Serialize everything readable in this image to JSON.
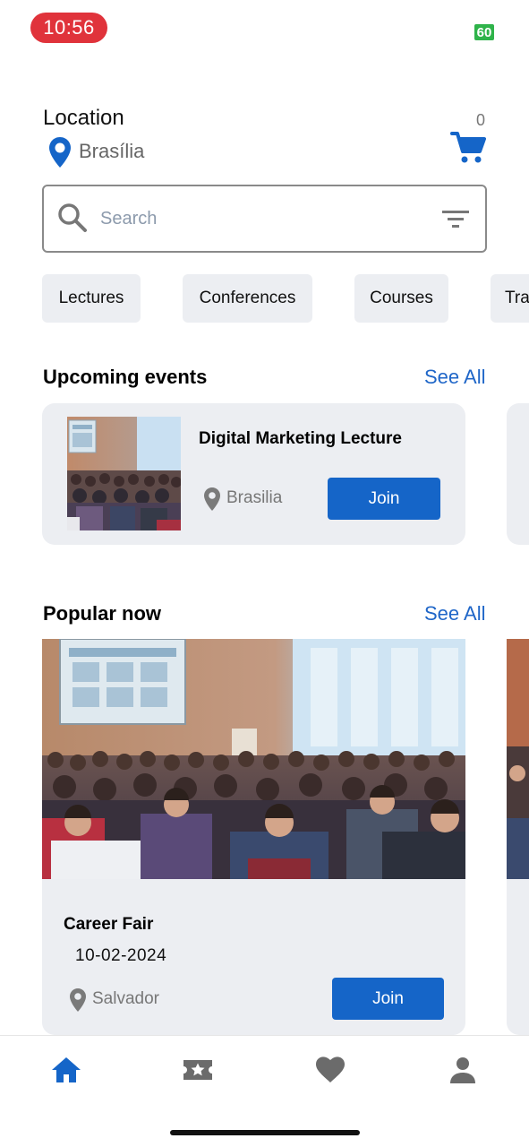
{
  "status_bar": {
    "time": "10:56",
    "battery": "60"
  },
  "header": {
    "location_label": "Location",
    "location_city": "Brasília",
    "cart_count": "0",
    "icons": {
      "location": "map-pin-icon",
      "cart": "shopping-cart-icon"
    }
  },
  "search": {
    "placeholder": "Search",
    "value": "",
    "icons": {
      "search": "search-icon",
      "filter": "filter-icon"
    }
  },
  "categories": [
    "Lectures",
    "Conferences",
    "Courses",
    "Tra"
  ],
  "upcoming": {
    "title": "Upcoming events",
    "see_all": "See All",
    "event": {
      "title": "Digital Marketing Lecture",
      "city": "Brasilia",
      "join_label": "Join"
    }
  },
  "popular": {
    "title": "Popular now",
    "see_all": "See All",
    "event": {
      "title": "Career Fair",
      "date": "10-02-2024",
      "city": "Salvador",
      "join_label": "Join"
    }
  },
  "bottom_nav": {
    "items": [
      {
        "icon": "home-icon",
        "active": true
      },
      {
        "icon": "ticket-icon",
        "active": false
      },
      {
        "icon": "heart-icon",
        "active": false
      },
      {
        "icon": "profile-icon",
        "active": false
      }
    ]
  },
  "colors": {
    "accent": "#1565c8",
    "card_bg": "#eceef2",
    "time_pill": "#e0333b",
    "battery": "#2fb34a",
    "inactive_icon": "#6b6b6b"
  }
}
